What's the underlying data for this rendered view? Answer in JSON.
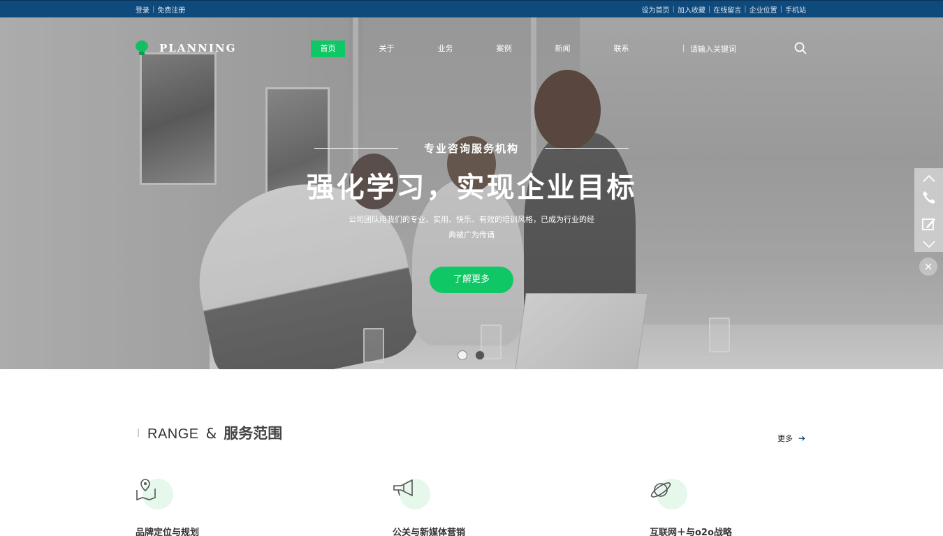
{
  "topbar": {
    "left_links": [
      "登录",
      "免费注册"
    ],
    "right_links": [
      "设为首页",
      "加入收藏",
      "在线留言",
      "企业位置",
      "手机站"
    ]
  },
  "brand": {
    "name": "PLANNING",
    "accent": "#0fc865",
    "topbar_color": "#0f4a7c"
  },
  "nav": {
    "items": [
      {
        "label": "首页",
        "active": true
      },
      {
        "label": "关于",
        "active": false
      },
      {
        "label": "业务",
        "active": false
      },
      {
        "label": "案例",
        "active": false
      },
      {
        "label": "新闻",
        "active": false
      },
      {
        "label": "联系",
        "active": false
      }
    ],
    "search_placeholder": "请输入关键词",
    "search_icon": "search-icon"
  },
  "hero": {
    "kicker": "专业咨询服务机构",
    "headline": "强化学习，实现企业目标",
    "description": "公司团队用我们的专业、实用、快乐、有效的培训风格，已成为行业的经典被广为传诵",
    "button": "了解更多",
    "slides": 2,
    "active_slide": 1
  },
  "float_toolbar": {
    "icons": [
      "chevron-up-icon",
      "phone-icon",
      "edit-icon",
      "chevron-down-icon"
    ],
    "close_icon": "close-icon"
  },
  "services_section": {
    "title_en": "RANGE",
    "title_amp": "&",
    "title_cn": "服务范围",
    "more": "更多",
    "items": [
      {
        "name": "品牌定位与规划",
        "icon": "map-pin-icon"
      },
      {
        "name": "公关与新媒体营销",
        "icon": "megaphone-icon"
      },
      {
        "name": "互联网＋与o2o战略",
        "icon": "planet-icon"
      }
    ]
  }
}
